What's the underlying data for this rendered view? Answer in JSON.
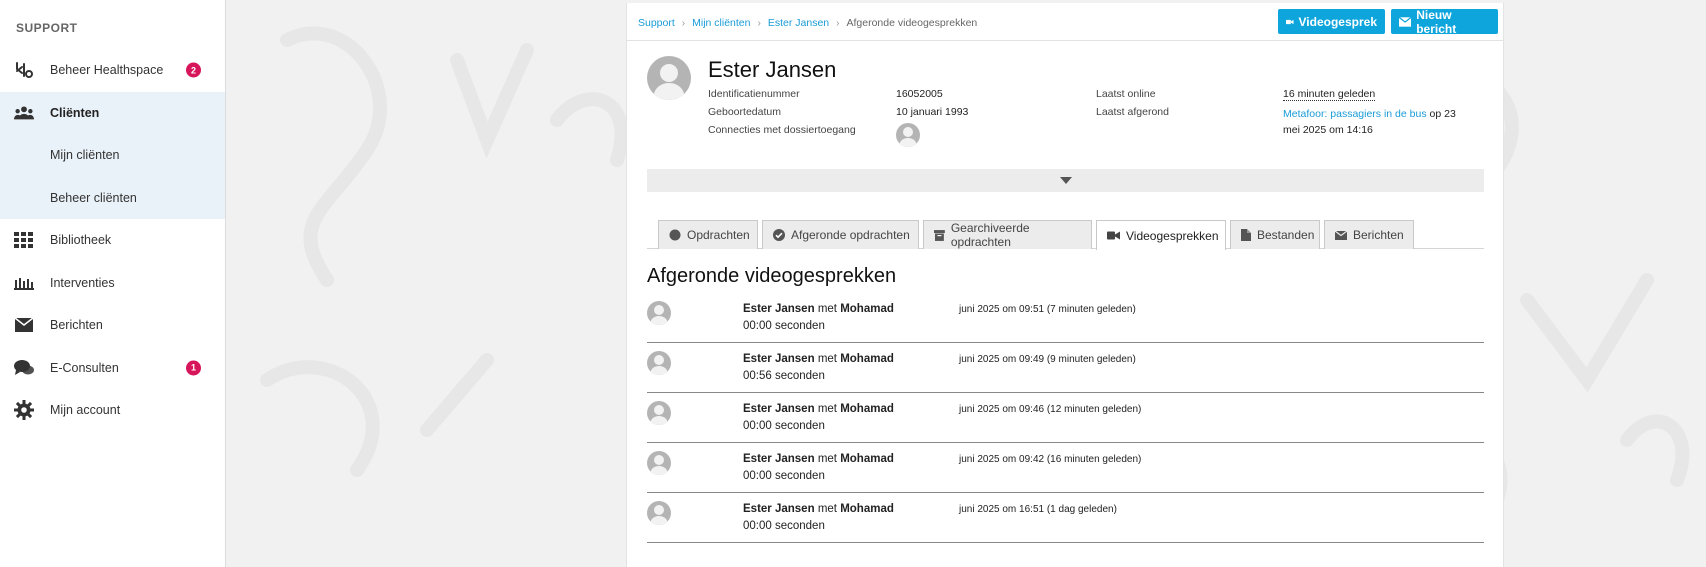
{
  "sidebar": {
    "heading": "SUPPORT",
    "items": [
      {
        "label": "Beheer Healthspace",
        "icon": "healthspace-icon",
        "badge": "2"
      },
      {
        "label": "Cliënten",
        "icon": "users-icon",
        "active": true
      },
      {
        "label": "Bibliotheek",
        "icon": "grid-icon"
      },
      {
        "label": "Interventies",
        "icon": "interventions-icon"
      },
      {
        "label": "Berichten",
        "icon": "envelope-icon"
      },
      {
        "label": "E-Consulten",
        "icon": "chat-icon",
        "badge": "1"
      },
      {
        "label": "Mijn account",
        "icon": "gear-icon"
      }
    ],
    "sub_items": [
      "Mijn cliënten",
      "Beheer cliënten"
    ]
  },
  "breadcrumb": [
    "Support",
    "Mijn cliënten",
    "Ester Jansen",
    "Afgeronde videogesprekken"
  ],
  "actions": {
    "video": "Videogesprek",
    "message": "Nieuw bericht"
  },
  "client": {
    "name": "Ester Jansen",
    "id_label": "Identificatienummer",
    "id_value": "16052005",
    "dob_label": "Geboortedatum",
    "dob_value": "10 januari 1993",
    "connections_label": "Connecties met dossiertoegang",
    "last_online_label": "Laatst online",
    "last_online_value": "16 minuten geleden",
    "last_completed_label": "Laatst afgerond",
    "last_completed_link": "Metafoor: passagiers in de bus",
    "last_completed_rest_1": " op 23",
    "last_completed_rest_2": "mei 2025 om 14:16"
  },
  "tabs": [
    {
      "label": "Opdrachten",
      "icon": "circle-icon"
    },
    {
      "label": "Afgeronde opdrachten",
      "icon": "check-circle-icon"
    },
    {
      "label": "Gearchiveerde opdrachten",
      "icon": "archive-icon"
    },
    {
      "label": "Videogesprekken",
      "icon": "video-icon",
      "active": true
    },
    {
      "label": "Bestanden",
      "icon": "file-icon"
    },
    {
      "label": "Berichten",
      "icon": "envelope-icon"
    }
  ],
  "section_title": "Afgeronde videogesprekken",
  "calls": [
    {
      "client": "Ester Jansen",
      "with": "met",
      "counsellor": "Mohamad",
      "date": "juni 2025 om 09:51 (7 minuten geleden)",
      "duration": "00:00 seconden"
    },
    {
      "client": "Ester Jansen",
      "with": "met",
      "counsellor": "Mohamad",
      "date": "juni 2025 om 09:49 (9 minuten geleden)",
      "duration": "00:56 seconden"
    },
    {
      "client": "Ester Jansen",
      "with": "met",
      "counsellor": "Mohamad",
      "date": "juni 2025 om 09:46 (12 minuten geleden)",
      "duration": "00:00 seconden"
    },
    {
      "client": "Ester Jansen",
      "with": "met",
      "counsellor": "Mohamad",
      "date": "juni 2025 om 09:42 (16 minuten geleden)",
      "duration": "00:00 seconden"
    },
    {
      "client": "Ester Jansen",
      "with": "met",
      "counsellor": "Mohamad",
      "date": "juni 2025 om 16:51 (1 dag geleden)",
      "duration": "00:00 seconden"
    }
  ],
  "colors": {
    "accent": "#0ea5dd",
    "badge": "#d6155a",
    "active_bg": "#eaf2f9"
  }
}
